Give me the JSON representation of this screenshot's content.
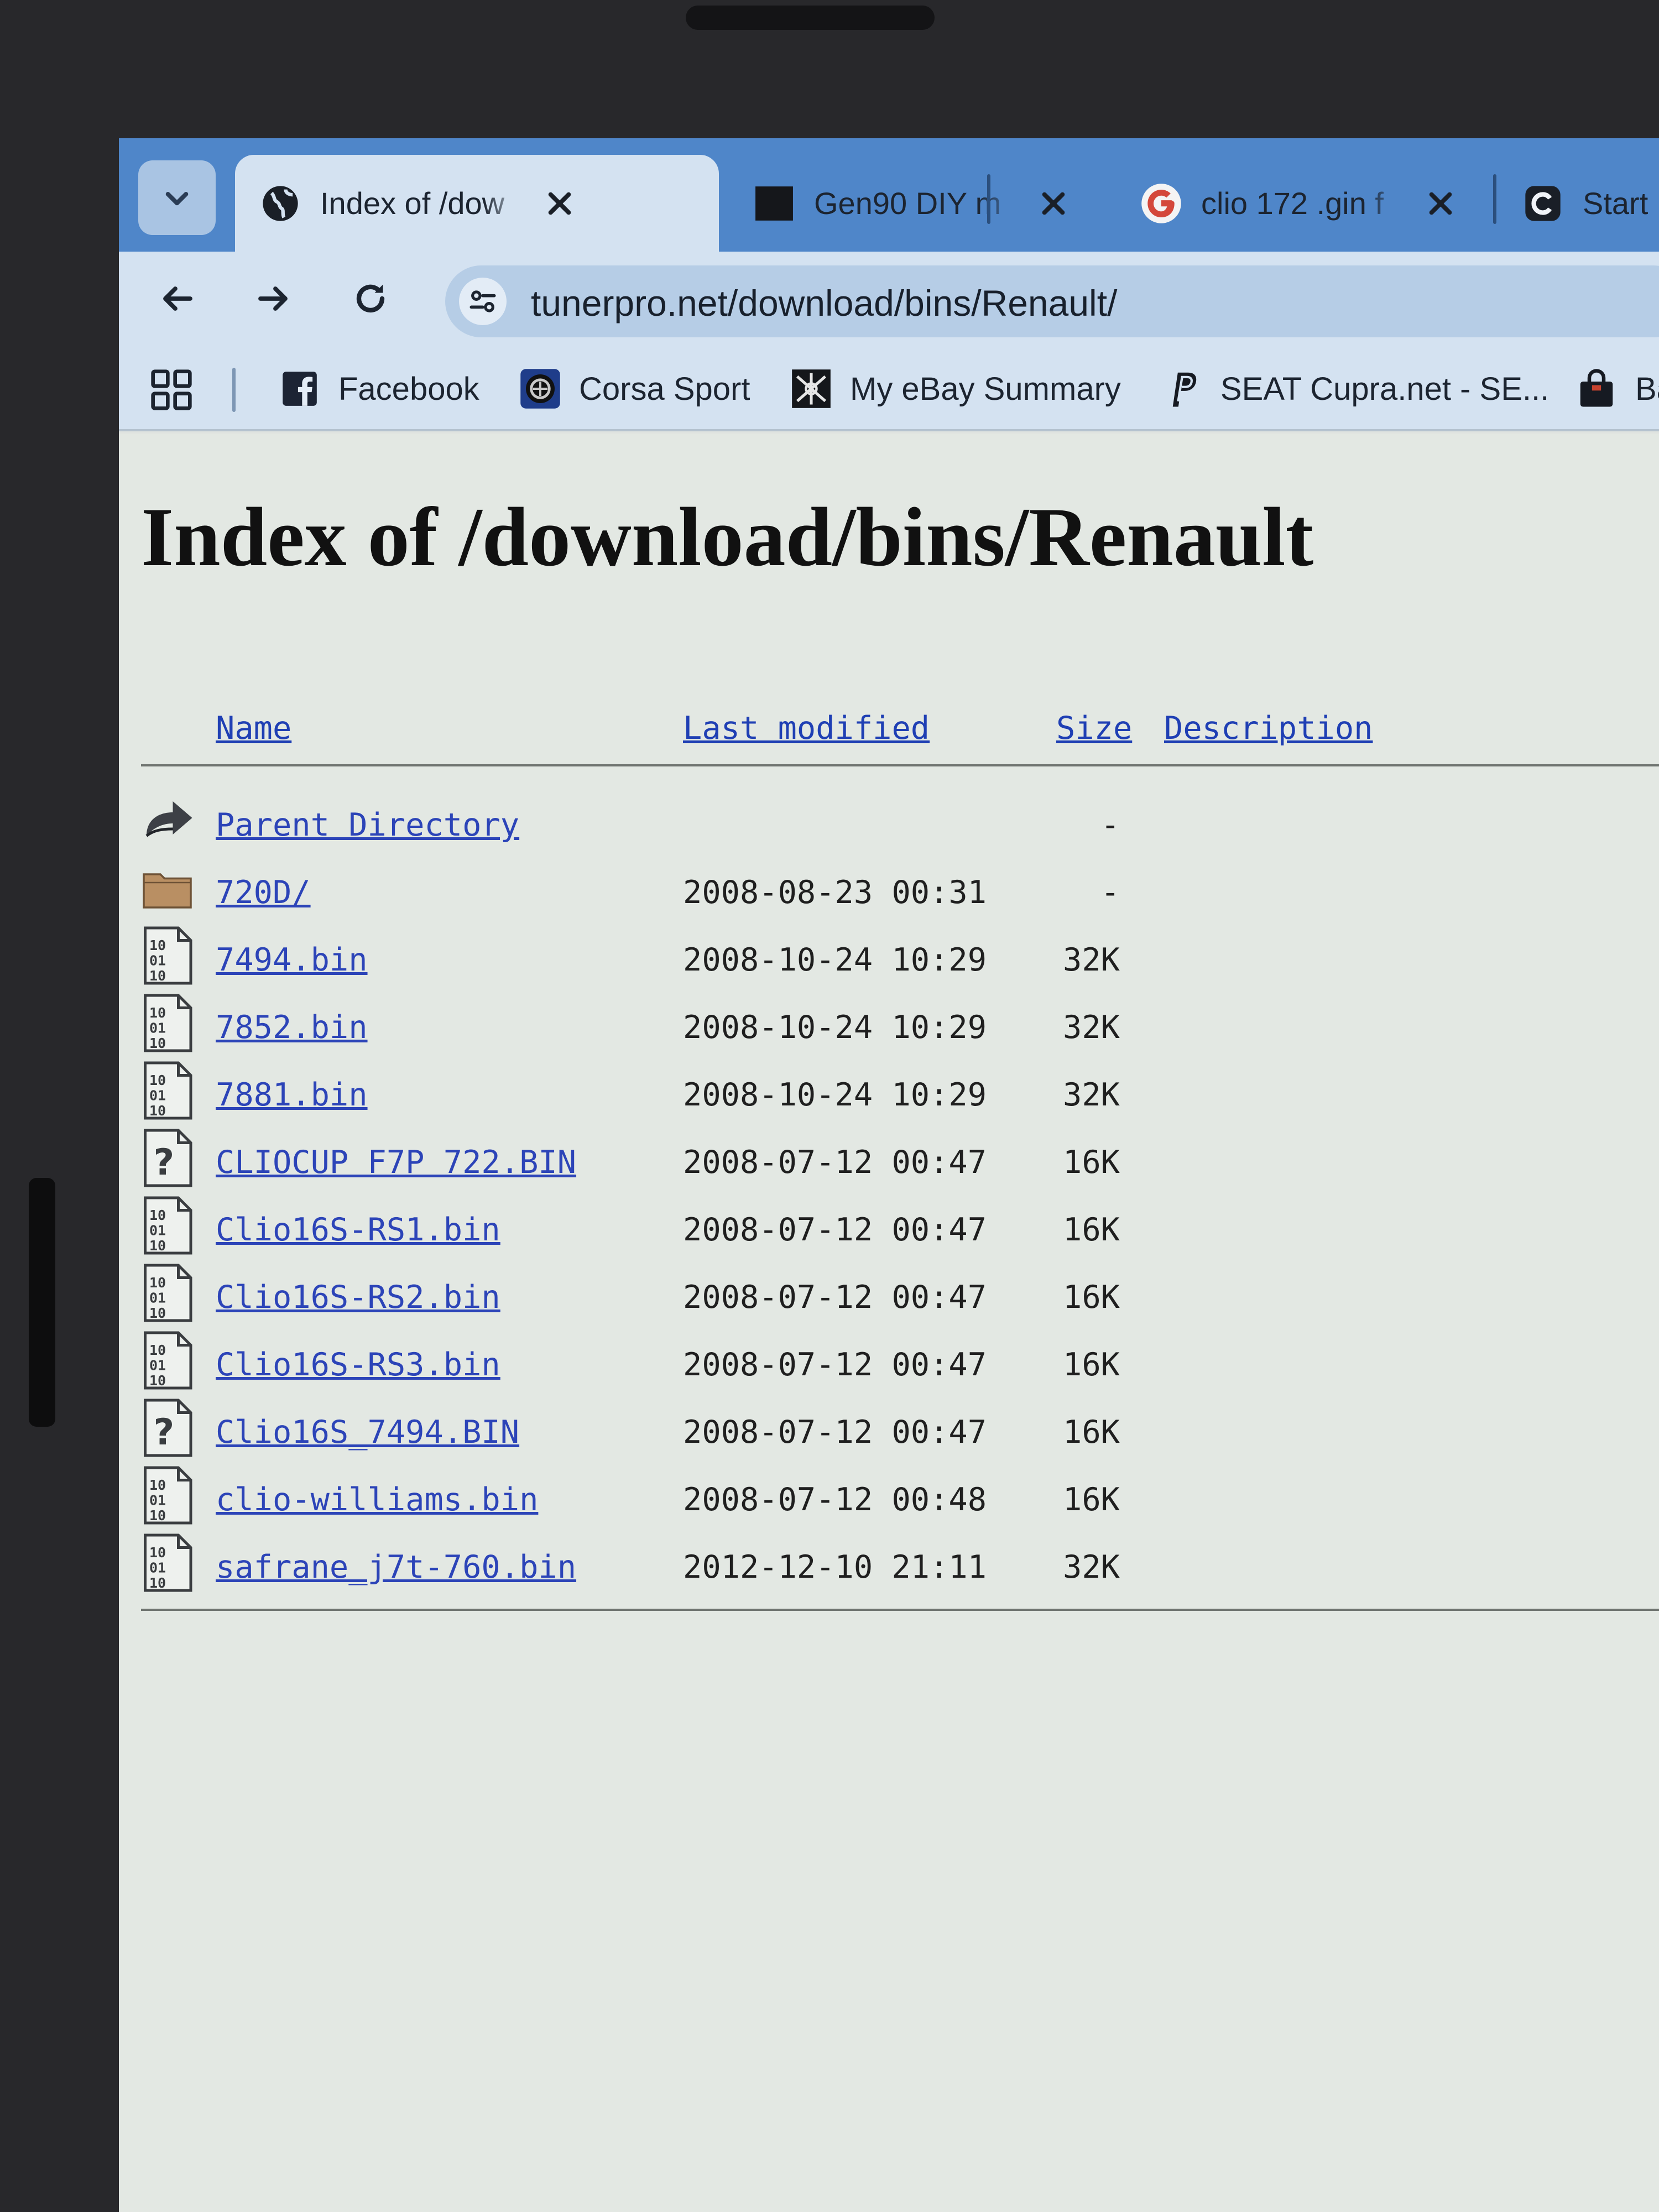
{
  "browser": {
    "tabs": [
      {
        "title": "Index of /dow",
        "favicon": "globe-icon",
        "active": true
      },
      {
        "title": "Gen90 DIY m",
        "favicon": "dark-square-icon",
        "active": false
      },
      {
        "title": "clio 172 .gin f",
        "favicon": "google-icon",
        "active": false
      },
      {
        "title": "Start Maps &",
        "favicon": "maps-icon",
        "active": false
      }
    ],
    "url": "tunerpro.net/download/bins/Renault/",
    "bookmarks": [
      {
        "label": "Facebook",
        "favicon": "facebook-icon"
      },
      {
        "label": "Corsa Sport",
        "favicon": "corsa-sport-icon"
      },
      {
        "label": "My eBay Summary",
        "favicon": "ebay-icon"
      },
      {
        "label": "SEAT Cupra.net - SE...",
        "favicon": "paypal-icon"
      },
      {
        "label": "Ba",
        "favicon": "shopping-bag-icon"
      }
    ]
  },
  "page": {
    "title": "Index of /download/bins/Renault",
    "columns": {
      "name": "Name",
      "last_modified": "Last modified",
      "size": "Size",
      "description": "Description"
    },
    "rows": [
      {
        "icon": "back-arrow-icon",
        "name": "Parent Directory",
        "date": "",
        "size": "-"
      },
      {
        "icon": "folder-icon",
        "name": "720D/",
        "date": "2008-08-23 00:31",
        "size": "-"
      },
      {
        "icon": "binary-file-icon",
        "name": "7494.bin",
        "date": "2008-10-24 10:29",
        "size": "32K"
      },
      {
        "icon": "binary-file-icon",
        "name": "7852.bin",
        "date": "2008-10-24 10:29",
        "size": "32K"
      },
      {
        "icon": "binary-file-icon",
        "name": "7881.bin",
        "date": "2008-10-24 10:29",
        "size": "32K"
      },
      {
        "icon": "unknown-file-icon",
        "name": "CLIOCUP F7P 722.BIN",
        "date": "2008-07-12 00:47",
        "size": "16K"
      },
      {
        "icon": "binary-file-icon",
        "name": "Clio16S-RS1.bin",
        "date": "2008-07-12 00:47",
        "size": "16K"
      },
      {
        "icon": "binary-file-icon",
        "name": "Clio16S-RS2.bin",
        "date": "2008-07-12 00:47",
        "size": "16K"
      },
      {
        "icon": "binary-file-icon",
        "name": "Clio16S-RS3.bin",
        "date": "2008-07-12 00:47",
        "size": "16K"
      },
      {
        "icon": "unknown-file-icon",
        "name": "Clio16S_7494.BIN",
        "date": "2008-07-12 00:47",
        "size": "16K"
      },
      {
        "icon": "binary-file-icon",
        "name": "clio-williams.bin",
        "date": "2008-07-12 00:48",
        "size": "16K"
      },
      {
        "icon": "binary-file-icon",
        "name": "safrane_j7t-760.bin",
        "date": "2012-12-10 21:11",
        "size": "32K"
      }
    ]
  }
}
